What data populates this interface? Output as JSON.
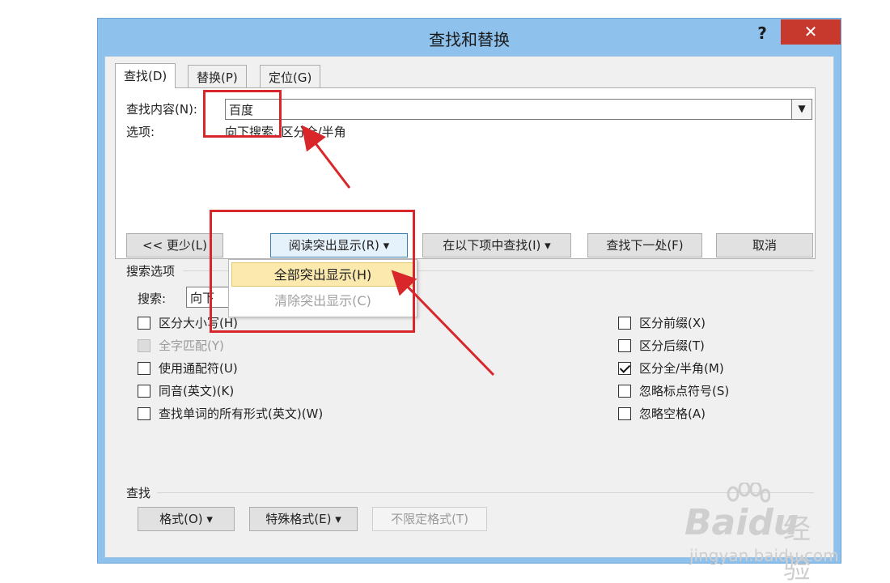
{
  "dialog": {
    "title": "查找和替换",
    "help": "?",
    "close": "✕"
  },
  "tabs": [
    {
      "label": "查找(D)",
      "active": true
    },
    {
      "label": "替换(P)",
      "active": false
    },
    {
      "label": "定位(G)",
      "active": false
    }
  ],
  "find": {
    "label": "查找内容(N):",
    "value": "百度",
    "options_label": "选项:",
    "options_value": "向下搜索, 区分全/半角"
  },
  "buttons": {
    "less": "<< 更少(L)",
    "reading_highlight": "阅读突出显示(R) ▾",
    "find_in": "在以下项中查找(I) ▾",
    "find_next": "查找下一处(F)",
    "cancel": "取消"
  },
  "highlight_menu": [
    {
      "label": "全部突出显示(H)",
      "enabled": true
    },
    {
      "label": "清除突出显示(C)",
      "enabled": false
    }
  ],
  "search_options": {
    "title": "搜索选项",
    "direction_label": "搜索:",
    "direction_value": "向下",
    "left_checks": [
      {
        "label": "区分大小写(H)",
        "checked": false,
        "enabled": true
      },
      {
        "label": "全字匹配(Y)",
        "checked": false,
        "enabled": false
      },
      {
        "label": "使用通配符(U)",
        "checked": false,
        "enabled": true
      },
      {
        "label": "同音(英文)(K)",
        "checked": false,
        "enabled": true
      },
      {
        "label": "查找单词的所有形式(英文)(W)",
        "checked": false,
        "enabled": true
      }
    ],
    "right_checks": [
      {
        "label": "区分前缀(X)",
        "checked": false,
        "enabled": true
      },
      {
        "label": "区分后缀(T)",
        "checked": false,
        "enabled": true
      },
      {
        "label": "区分全/半角(M)",
        "checked": true,
        "enabled": true
      },
      {
        "label": "忽略标点符号(S)",
        "checked": false,
        "enabled": true
      },
      {
        "label": "忽略空格(A)",
        "checked": false,
        "enabled": true
      }
    ]
  },
  "find_section": {
    "title": "查找",
    "format": "格式(O) ▾",
    "special": "特殊格式(E) ▾",
    "no_format": "不限定格式(T)"
  },
  "watermark": {
    "brand": "Bai",
    "brand_du": "du",
    "product": "经验",
    "url": "jingyan.baidu.com"
  },
  "colors": {
    "title_bar": "#8ec1ec",
    "close": "#c7392d",
    "annotation": "#d8262a",
    "menu_hover": "#fbe9ae"
  }
}
